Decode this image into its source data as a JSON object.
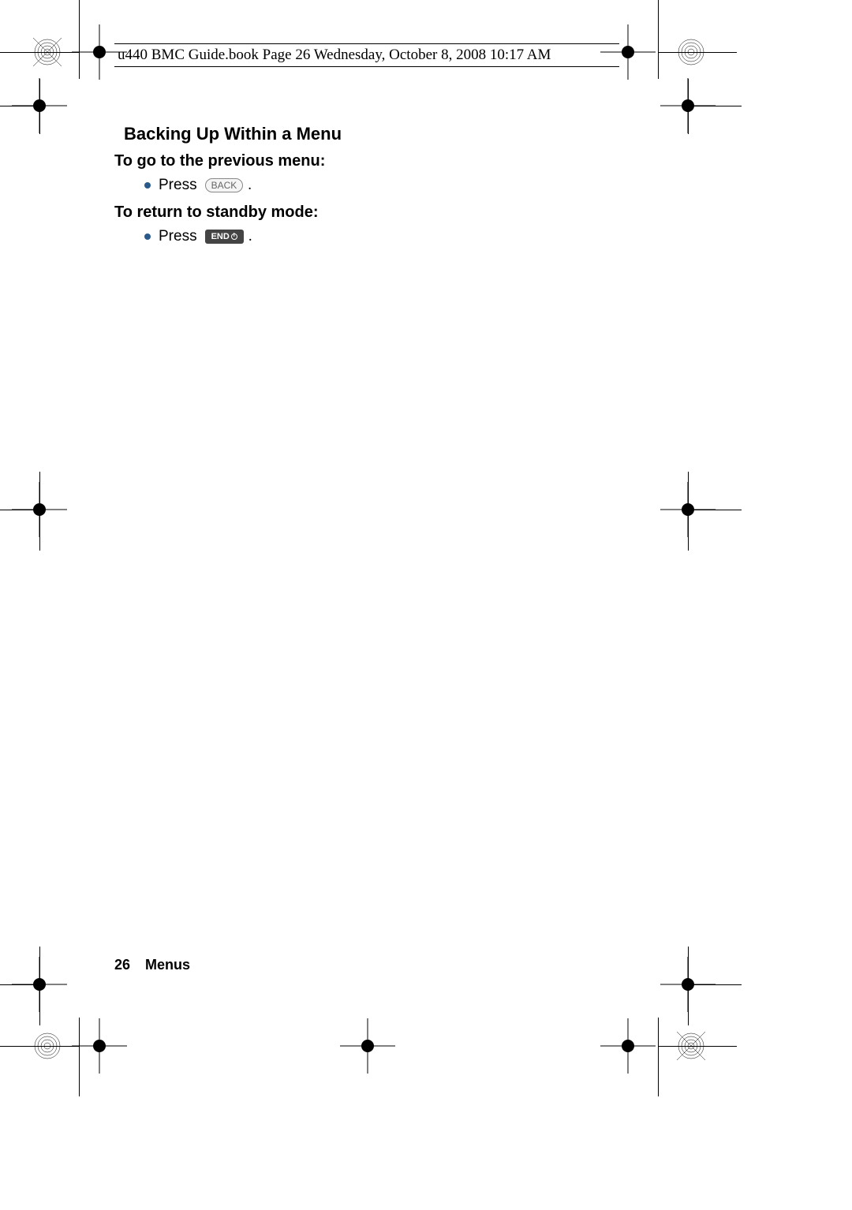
{
  "header": {
    "text": "u440 BMC Guide.book  Page 26  Wednesday, October 8, 2008  10:17 AM"
  },
  "content": {
    "heading1": "Backing Up Within a Menu",
    "section1": {
      "heading": "To go to the previous menu:",
      "bullet_text": "Press",
      "key_label": "BACK",
      "period": "."
    },
    "section2": {
      "heading": "To return to standby mode:",
      "bullet_text": "Press",
      "key_label": "END",
      "period": "."
    }
  },
  "footer": {
    "page_number": "26",
    "chapter": "Menus"
  }
}
